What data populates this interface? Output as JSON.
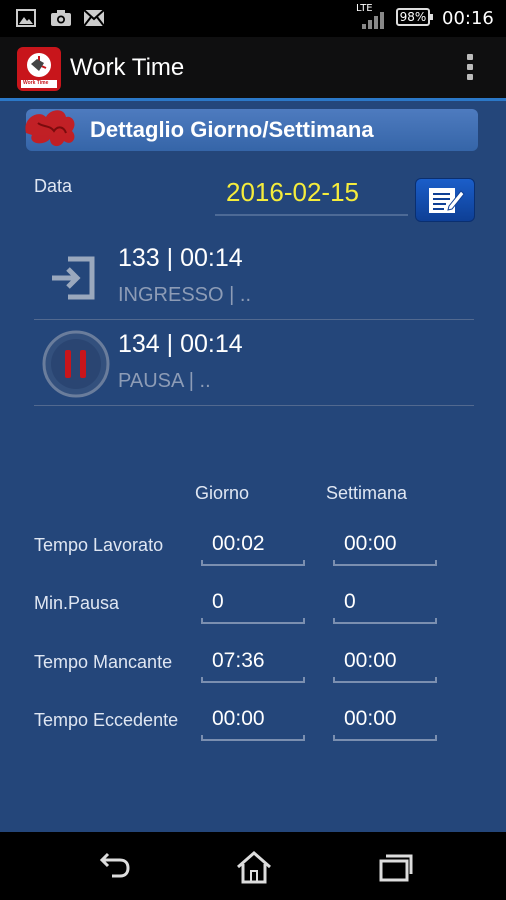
{
  "status_bar": {
    "icons": [
      "image-icon",
      "camera-icon",
      "mail-icon",
      "lte-signal-icon",
      "battery-icon"
    ],
    "network": "LTE",
    "battery": "98%",
    "time": "00:16"
  },
  "action_bar": {
    "title": "Work Time",
    "logo_text": "Work Time",
    "overflow_icon": "more-vertical-icon"
  },
  "section": {
    "title": "Dettaglio Giorno/Settimana"
  },
  "date_field": {
    "label": "Data",
    "value": "2016-02-15",
    "edit_icon": "edit-note-icon"
  },
  "entries": [
    {
      "main": "133 | 00:14",
      "sub": "INGRESSO | ..",
      "icon": "login-icon"
    },
    {
      "main": "134 | 00:14",
      "sub": "PAUSA | ..",
      "icon": "pause-icon"
    }
  ],
  "summary": {
    "col_day": "Giorno",
    "col_week": "Settimana",
    "rows": [
      {
        "label": "Tempo Lavorato",
        "day": "00:02",
        "week": "00:00"
      },
      {
        "label": "Min.Pausa",
        "day": "0",
        "week": "0"
      },
      {
        "label": "Tempo Mancante",
        "day": "07:36",
        "week": "00:00"
      },
      {
        "label": "Tempo Eccedente",
        "day": "00:00",
        "week": "00:00"
      }
    ]
  },
  "nav_bar": {
    "back": "back-icon",
    "home": "home-icon",
    "recents": "recents-icon"
  },
  "colors": {
    "content_bg": "#24467a",
    "date_value": "#f5ec3c",
    "accent": "#2b78c8",
    "logo_red": "#c8151b"
  }
}
